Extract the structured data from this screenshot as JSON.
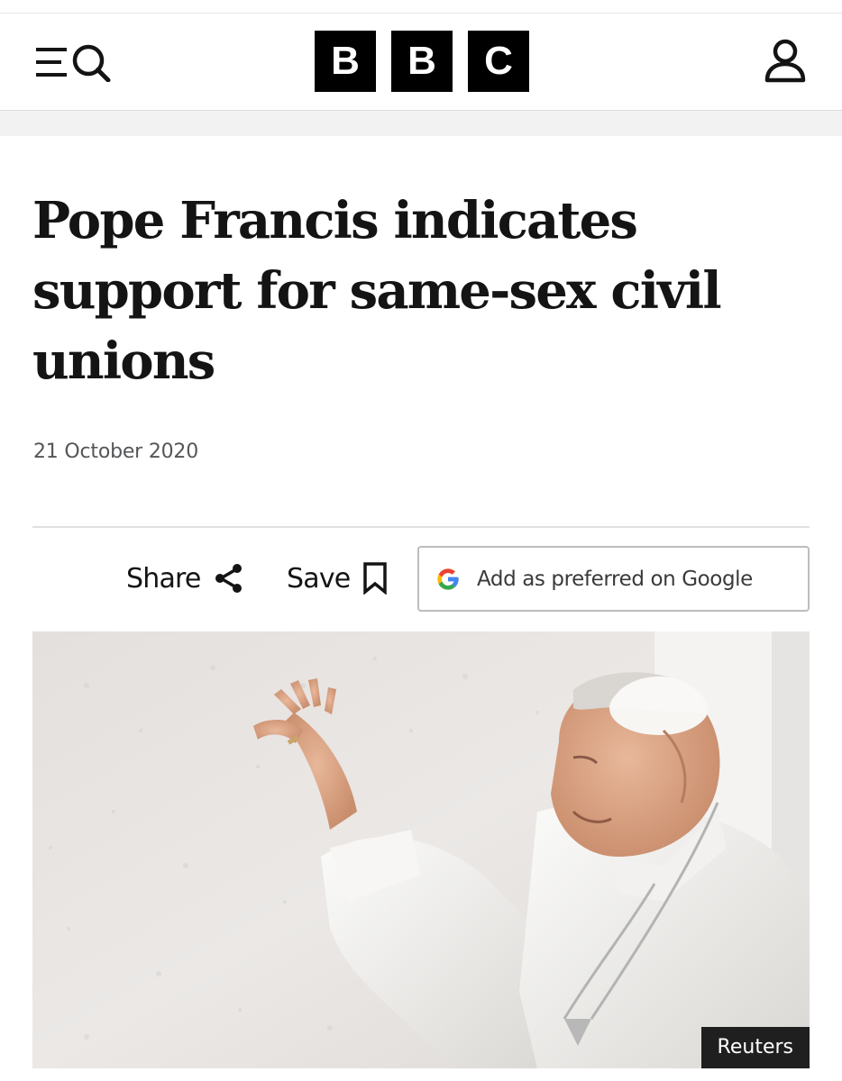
{
  "header": {
    "logo_letters": [
      "B",
      "B",
      "C"
    ],
    "icons": {
      "menu": "menu-icon",
      "search": "search-icon",
      "account": "account-icon"
    }
  },
  "article": {
    "headline": "Pope Francis indicates support for same-sex civil unions",
    "date": "21 October 2020"
  },
  "actions": {
    "share_label": "Share",
    "save_label": "Save",
    "google_label": "Add as preferred on Google",
    "icons": {
      "share": "share-icon",
      "save": "bookmark-icon",
      "google": "google-g-icon"
    }
  },
  "image": {
    "credit": "Reuters"
  },
  "colors": {
    "logo_block": "#000000",
    "text": "#141414",
    "date_text": "#545658",
    "google_blue": "#4285F4",
    "google_red": "#EA4335",
    "google_yellow": "#FBBC05",
    "google_green": "#34A853"
  }
}
